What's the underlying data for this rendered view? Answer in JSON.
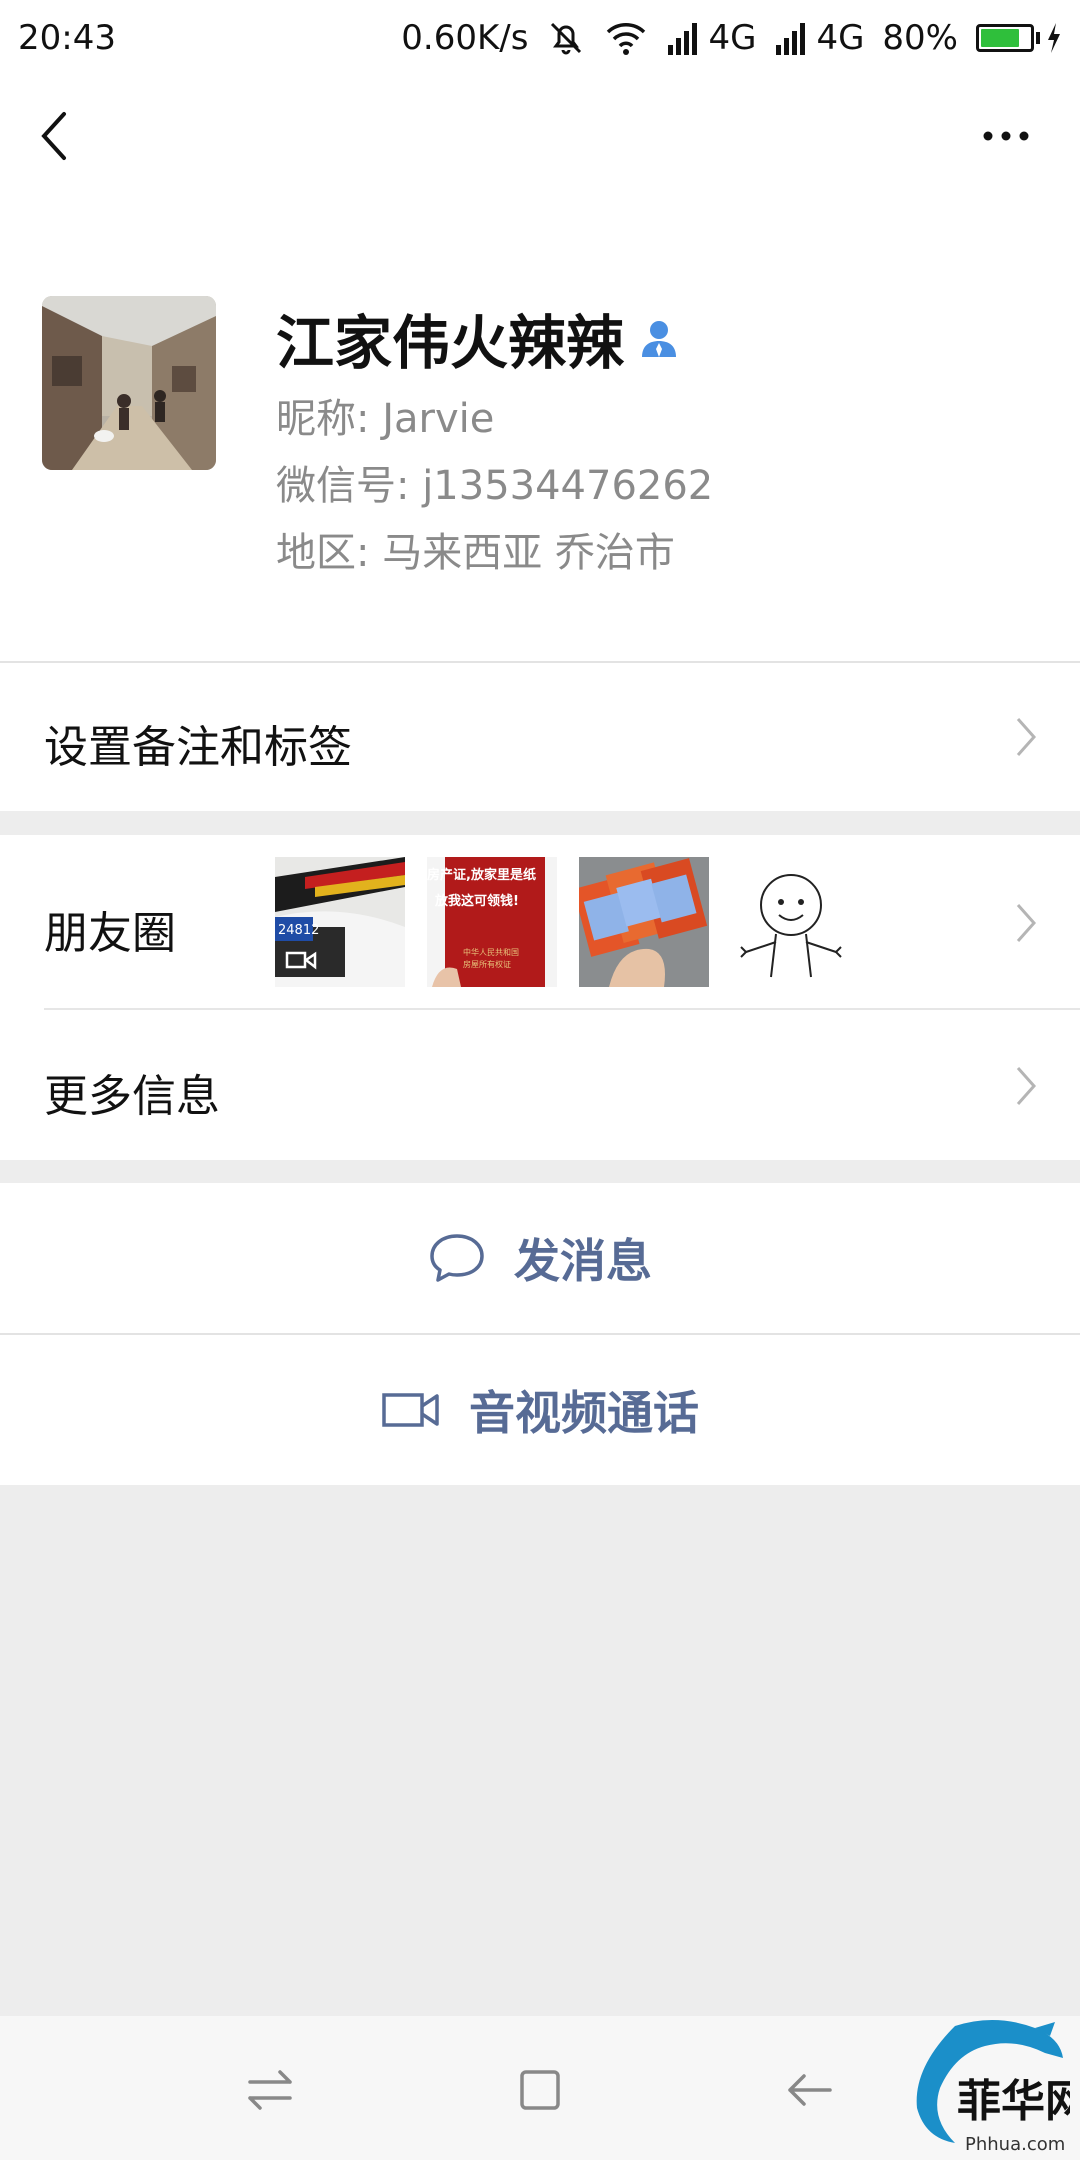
{
  "status_bar": {
    "time": "20:43",
    "speed": "0.60K/s",
    "network1": "4G",
    "network2": "4G",
    "battery": "80%",
    "battery_level": 0.8
  },
  "profile": {
    "name": "江家伟火辣辣",
    "nickname": "昵称: Jarvie",
    "wechat_id": "微信号: j13534476262",
    "region": "地区: 马来西亚  乔治市"
  },
  "rows": {
    "remark": "设置备注和标签",
    "moments": "朋友圈",
    "more_info": "更多信息"
  },
  "moments_thumbs": {
    "thumb2_line1": "房产证,放家里是纸",
    "thumb2_line2": "放我这可领钱!",
    "thumb2_line3": "中华人民共和国",
    "thumb2_line4": "房屋所有权证",
    "car_plate": "24812"
  },
  "actions": {
    "message": "发消息",
    "call": "音视频通话"
  },
  "watermark": {
    "brand": "菲华网",
    "url": "Phhua.com"
  }
}
